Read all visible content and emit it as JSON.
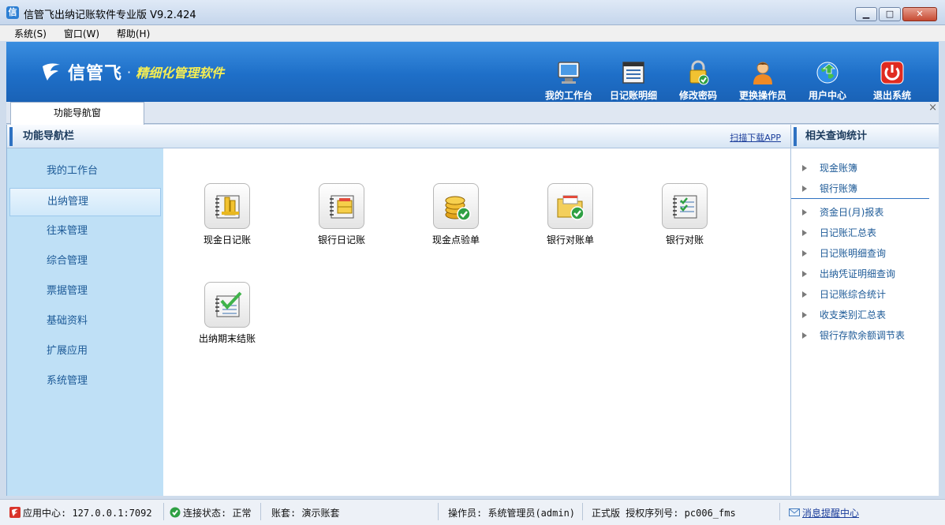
{
  "window": {
    "title": "信管飞出纳记账软件专业版 V9.2.424",
    "icon": "app-logo-icon"
  },
  "menu": [
    "系统(S)",
    "窗口(W)",
    "帮助(H)"
  ],
  "banner": {
    "logo_name": "信管飞",
    "slogan": "精细化管理软件",
    "tools": [
      {
        "label": "我的工作台",
        "icon": "monitor-icon"
      },
      {
        "label": "日记账明细",
        "icon": "ledger-list-icon"
      },
      {
        "label": "修改密码",
        "icon": "lock-icon"
      },
      {
        "label": "更换操作员",
        "icon": "user-icon"
      },
      {
        "label": "用户中心",
        "icon": "globe-icon"
      },
      {
        "label": "退出系统",
        "icon": "power-icon"
      }
    ]
  },
  "tabs": {
    "active": "功能导航窗",
    "close": "×"
  },
  "left": {
    "header": "功能导航栏",
    "items": [
      "我的工作台",
      "出纳管理",
      "往来管理",
      "综合管理",
      "票据管理",
      "基础资料",
      "扩展应用",
      "系统管理"
    ],
    "active_index": 1
  },
  "center": {
    "scan_link": "扫描下载APP",
    "functions": [
      {
        "label": "现金日记账",
        "icon": "cash-journal-icon"
      },
      {
        "label": "银行日记账",
        "icon": "bank-journal-icon"
      },
      {
        "label": "现金点验单",
        "icon": "coin-check-icon"
      },
      {
        "label": "银行对账单",
        "icon": "folder-check-icon"
      },
      {
        "label": "银行对账",
        "icon": "notebook-check-icon"
      },
      {
        "label": "出纳期末结账",
        "icon": "period-close-icon"
      }
    ]
  },
  "right": {
    "header": "相关查询统计",
    "links": [
      "现金账簿",
      "银行账簿",
      "资金日(月)报表",
      "日记账汇总表",
      "日记账明细查询",
      "出纳凭证明细查询",
      "日记账综合统计",
      "收支类别汇总表",
      "银行存款余额调节表"
    ]
  },
  "status": {
    "app_center": "应用中心: 127.0.0.1:7092",
    "connection": "连接状态: 正常",
    "account": "账套: 演示账套",
    "operator": "操作员: 系统管理员(admin)",
    "license": "正式版 授权序列号: pc006_fms",
    "message_center": "消息提醒中心"
  },
  "colors": {
    "banner": "#1e6fc8",
    "slogan": "#f6ee52",
    "nav_text": "#1d5a97",
    "left_bg": "#bfe0f6"
  }
}
